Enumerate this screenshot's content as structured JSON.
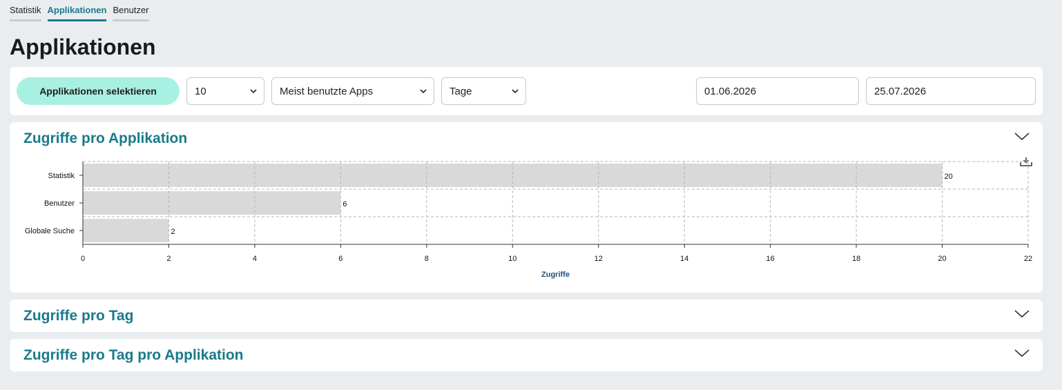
{
  "tabs": [
    {
      "label": "Statistik"
    },
    {
      "label": "Applikationen"
    },
    {
      "label": "Benutzer"
    }
  ],
  "active_tab": "Applikationen",
  "page_title": "Applikationen",
  "toolbar": {
    "select_button_label": "Applikationen selektieren",
    "limit_value": "10",
    "sort_value": "Meist benutzte Apps",
    "granularity_value": "Tage",
    "date_from": "01.06.2026",
    "date_to": "25.07.2026"
  },
  "sections": {
    "per_app_title": "Zugriffe pro Applikation",
    "per_day_title": "Zugriffe pro Tag",
    "per_day_per_app_title": "Zugriffe pro Tag pro Applikation"
  },
  "colors": {
    "accent": "#1a7a8a",
    "button_bg": "#a8f0e2",
    "bar_fill": "#d9d9d9",
    "axis_label": "#1f4e79"
  },
  "icons": {
    "collapse": "chevron-down-icon",
    "download": "download-icon",
    "dropdown": "chevron-down-icon"
  },
  "chart_data": {
    "type": "bar",
    "orientation": "horizontal",
    "categories": [
      "Statistik",
      "Benutzer",
      "Globale Suche"
    ],
    "values": [
      20,
      6,
      2
    ],
    "data_labels": [
      "20",
      "6",
      "2"
    ],
    "xlabel": "Zugriffe",
    "ylabel": "",
    "xlim": [
      0,
      22
    ],
    "x_ticks": [
      0,
      2,
      4,
      6,
      8,
      10,
      12,
      14,
      16,
      18,
      20,
      22
    ],
    "grid": true
  }
}
